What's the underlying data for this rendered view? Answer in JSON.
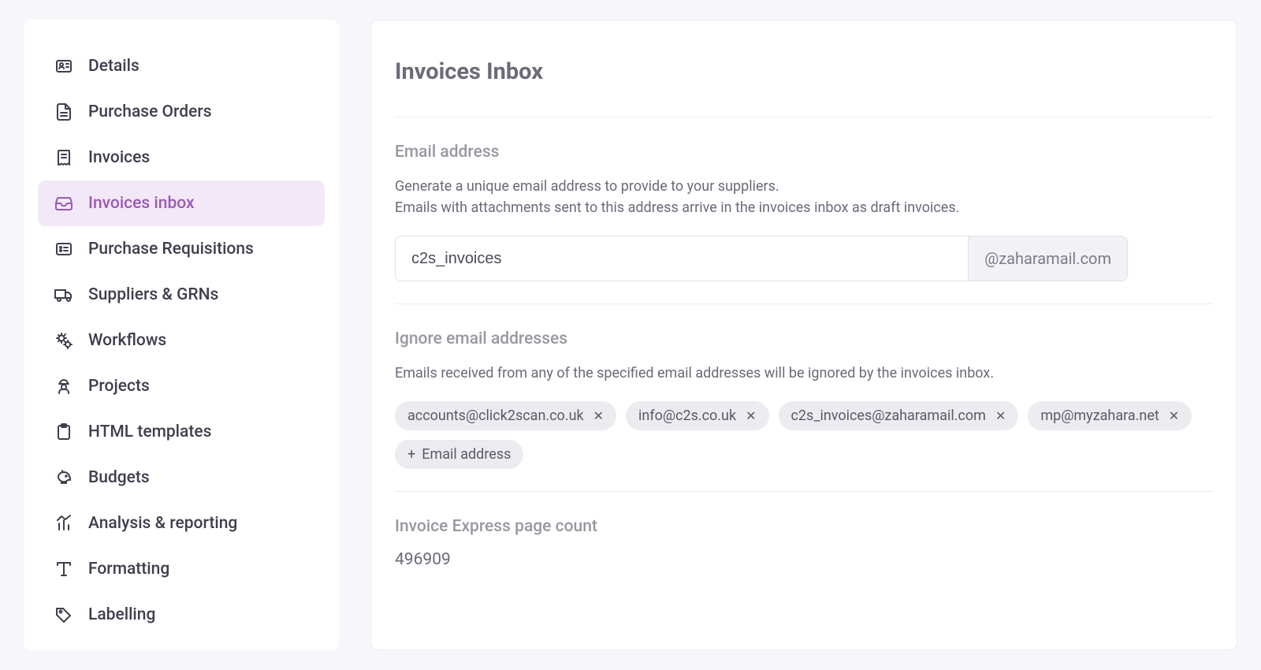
{
  "sidebar": {
    "items": [
      {
        "label": "Details"
      },
      {
        "label": "Purchase Orders"
      },
      {
        "label": "Invoices"
      },
      {
        "label": "Invoices inbox"
      },
      {
        "label": "Purchase Requisitions"
      },
      {
        "label": "Suppliers & GRNs"
      },
      {
        "label": "Workflows"
      },
      {
        "label": "Projects"
      },
      {
        "label": "HTML templates"
      },
      {
        "label": "Budgets"
      },
      {
        "label": "Analysis & reporting"
      },
      {
        "label": "Formatting"
      },
      {
        "label": "Labelling"
      }
    ],
    "active_index": 3
  },
  "main": {
    "title": "Invoices Inbox",
    "email": {
      "label": "Email address",
      "desc1": "Generate a unique email address to provide to your suppliers.",
      "desc2": "Emails with attachments sent to this address arrive in the invoices inbox as draft invoices.",
      "value": "c2s_invoices",
      "suffix": "@zaharamail.com"
    },
    "ignore": {
      "label": "Ignore email addresses",
      "desc": "Emails received from any of the specified email addresses will be ignored by the invoices inbox.",
      "chips": [
        "accounts@click2scan.co.uk",
        "info@c2s.co.uk",
        "c2s_invoices@zaharamail.com",
        "mp@myzahara.net"
      ],
      "add_label": "Email address"
    },
    "count": {
      "label": "Invoice Express page count",
      "value": "496909"
    }
  }
}
